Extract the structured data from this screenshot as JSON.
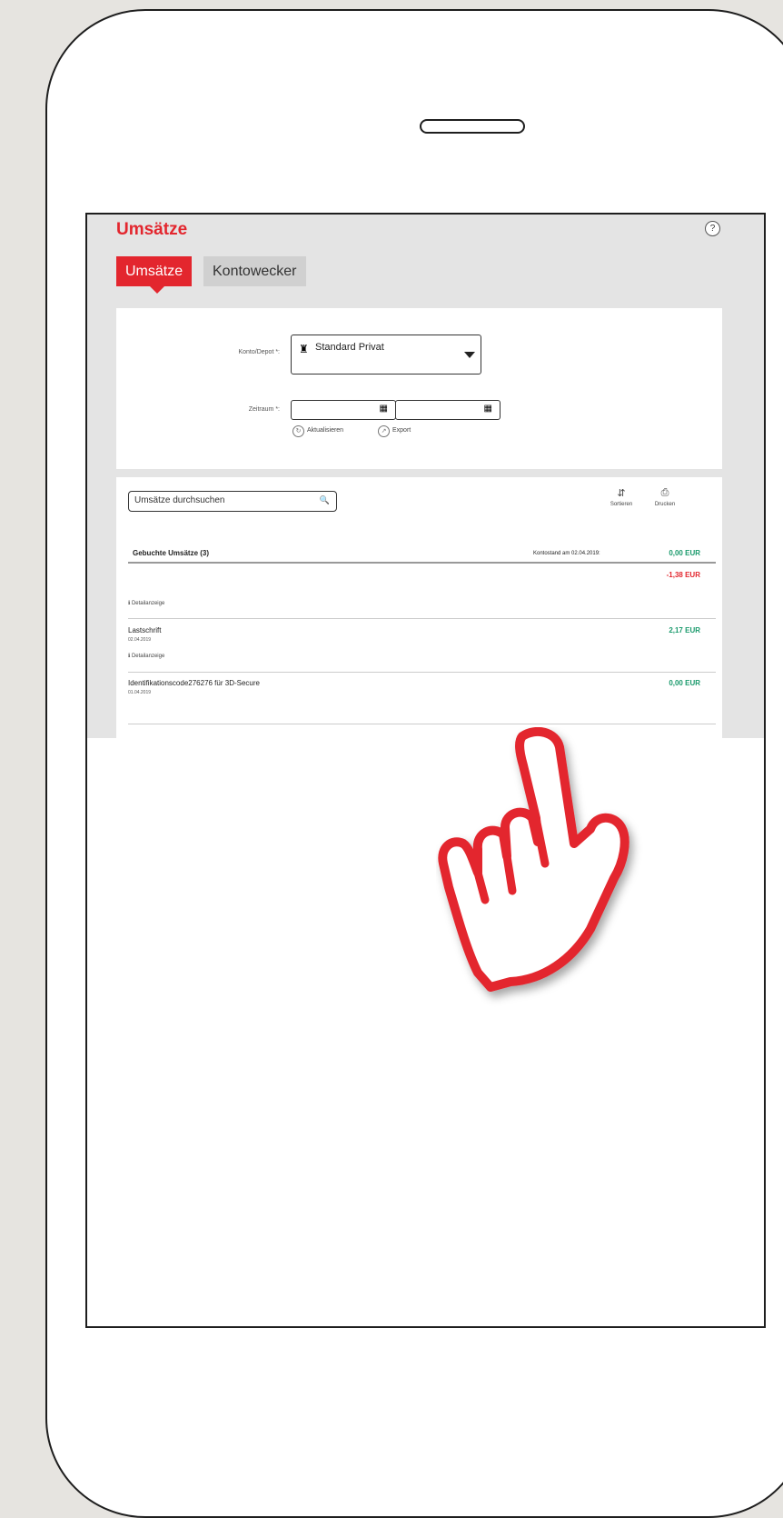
{
  "page": {
    "title": "Umsätze",
    "help_label": "?"
  },
  "tabs": [
    {
      "label": "Umsätze",
      "active": true
    },
    {
      "label": "Kontowecker",
      "active": false
    }
  ],
  "filter": {
    "account_label": "Konto/Depot *:",
    "account_value": "Standard Privat",
    "period_label": "Zeitraum *:",
    "refresh_label": "Aktualisieren",
    "export_label": "Export"
  },
  "list": {
    "search_placeholder": "Umsätze durchsuchen",
    "sort_label": "Sortieren",
    "print_label": "Drucken",
    "header": "Gebuchte Umsätze (3)",
    "balance_label": "Kontostand am 02.04.2019:",
    "balance_value": "0,00 EUR",
    "detail_label": "Detailanzeige",
    "transactions": [
      {
        "title": "",
        "date": "",
        "amount": "-1,38 EUR",
        "amount_color": "#e3262e"
      },
      {
        "title": "Lastschrift",
        "date": "02.04.2019",
        "amount": "2,17 EUR",
        "amount_color": "#1a9a6c"
      },
      {
        "title": "Identifikationscode276276 für 3D-Secure",
        "date": "01.04.2019",
        "amount": "0,00 EUR",
        "amount_color": "#1a9a6c"
      }
    ]
  },
  "colors": {
    "accent": "#e3262e",
    "positive": "#1a9a6c"
  },
  "icons": {
    "help": "help-icon",
    "bank": "bank-icon",
    "calendar": "calendar-icon",
    "search": "search-icon",
    "sort": "sort-icon",
    "print": "print-icon",
    "hand": "pointing-hand-icon"
  }
}
